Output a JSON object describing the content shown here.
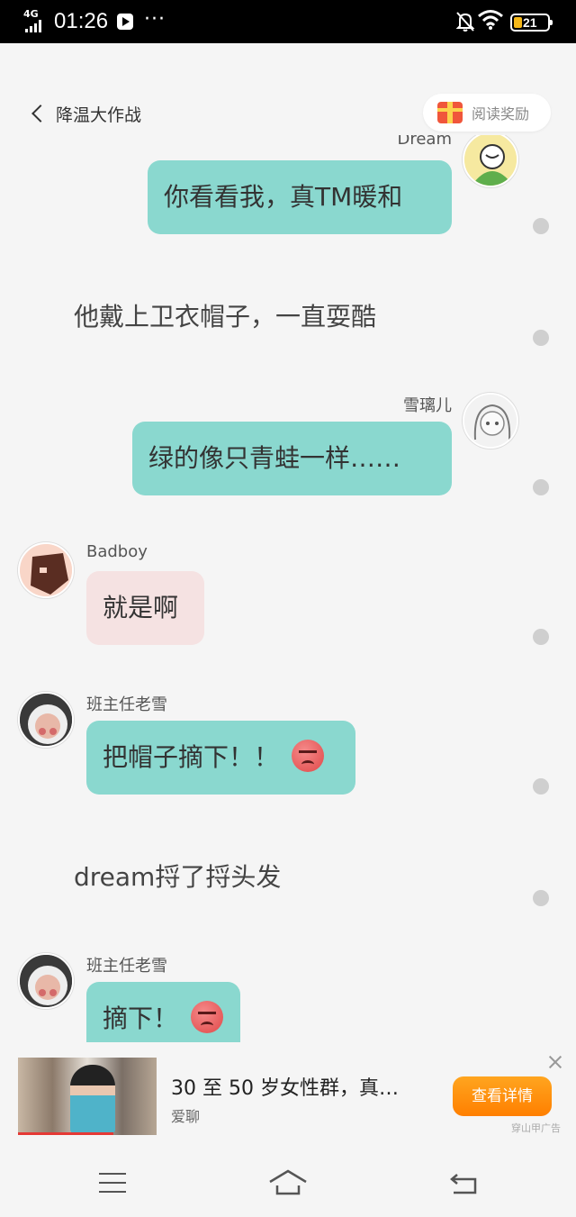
{
  "status_bar": {
    "network": "4G",
    "time": "01:26",
    "dots": "···",
    "battery": "21"
  },
  "header": {
    "back_title": "降温大作战",
    "reward_label": "阅读奖励"
  },
  "chat": {
    "msg1": {
      "sender": "Dream",
      "text": "你看看我，真TM暖和"
    },
    "narration1": "他戴上卫衣帽子，一直耍酷",
    "msg2": {
      "sender": "雪璃儿",
      "text": "绿的像只青蛙一样……"
    },
    "msg3": {
      "sender": "Badboy",
      "text": "就是啊"
    },
    "msg4": {
      "sender": "班主任老雪",
      "text": "把帽子摘下！！"
    },
    "narration2": "dream捋了捋头发",
    "msg5": {
      "sender": "班主任老雪",
      "text": "摘下！"
    }
  },
  "ad": {
    "title": "30 至 50 岁女性群，真…",
    "source": "爱聊",
    "cta": "查看详情",
    "tag": "穿山甲广告"
  },
  "colors": {
    "bubble_teal": "#8ad8cf",
    "bubble_pink": "#f5e2e2",
    "cta_orange": "#ff8c0a"
  }
}
